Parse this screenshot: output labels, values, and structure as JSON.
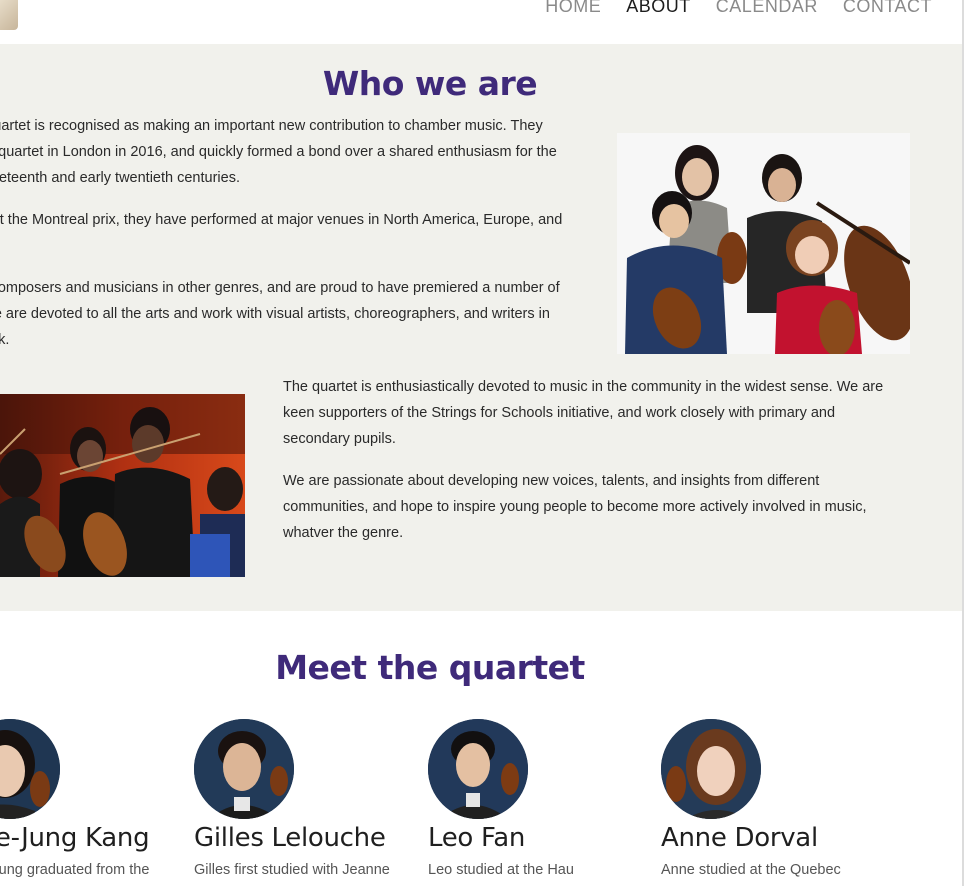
{
  "nav": {
    "items": [
      {
        "label": "HOME"
      },
      {
        "label": "ABOUT"
      },
      {
        "label": "CALENDAR"
      },
      {
        "label": "CONTACT"
      }
    ],
    "active_index": 1
  },
  "who": {
    "title": "Who we are",
    "left_paragraphs": [
      "The Colby String Quartet is recognised as making an important new contribution to chamber music. They came together as a quartet in London in 2016, and quickly formed a bond over a shared enthusiasm for the music of the late nineteenth and early twentieth centuries.",
      "Following success at the Montreal prix, they have performed at major venues in North America, Europe, and Japan.",
      "We also work with composers and musicians in other genres, and are proud to have premiered a number of chamber pieces. We are devoted to all the arts and work with visual artists, choreographers, and writers in developing new work."
    ],
    "right_paragraphs": [
      "The quartet is enthusiastically devoted to music in the community in the widest sense. We are keen supporters of the Strings for Schools initiative, and work closely with primary and secondary pupils.",
      "We are passionate about developing new voices, talents, and insights from different communities, and hope to inspire young people to become more actively involved in music, whatver the genre."
    ]
  },
  "meet": {
    "title": "Meet the quartet",
    "members": [
      {
        "name": "Hae-Jung Kang",
        "bio": "Hae-Jung graduated from the"
      },
      {
        "name": "Gilles Lelouche",
        "bio": "Gilles first studied with Jeanne"
      },
      {
        "name": "Leo Fan",
        "bio": "Leo studied at the Hau"
      },
      {
        "name": "Anne Dorval",
        "bio": "Anne studied at the Quebec"
      }
    ]
  },
  "colors": {
    "accent": "#3f2a7a",
    "section_bg": "#f1f1ec",
    "nav_active": "#1d1d1d",
    "nav_inactive": "#8a8a8a"
  }
}
